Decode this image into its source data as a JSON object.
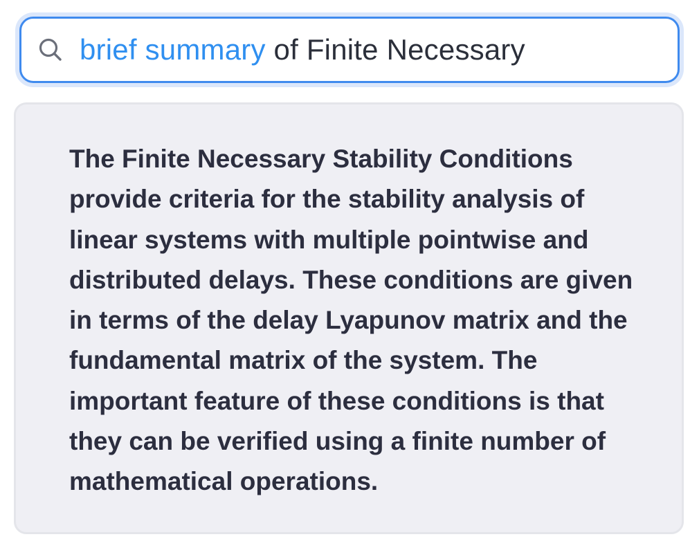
{
  "search": {
    "query_highlight": "brief summary",
    "query_rest": " of Finite Necessary",
    "icon": "search-icon"
  },
  "answer": {
    "text": "The Finite Necessary Stability Conditions provide criteria for the stability analysis of linear systems with multiple pointwise and distributed delays. These conditions are given in terms of the delay Lyapunov matrix and the fundamental matrix of the system. The important feature of these conditions is that they can be verified using a finite number of mathematical operations."
  },
  "colors": {
    "accent": "#3f8aee",
    "highlight_text": "#2f8ff0",
    "card_background": "#efeff4",
    "text": "#2c2e3f"
  }
}
